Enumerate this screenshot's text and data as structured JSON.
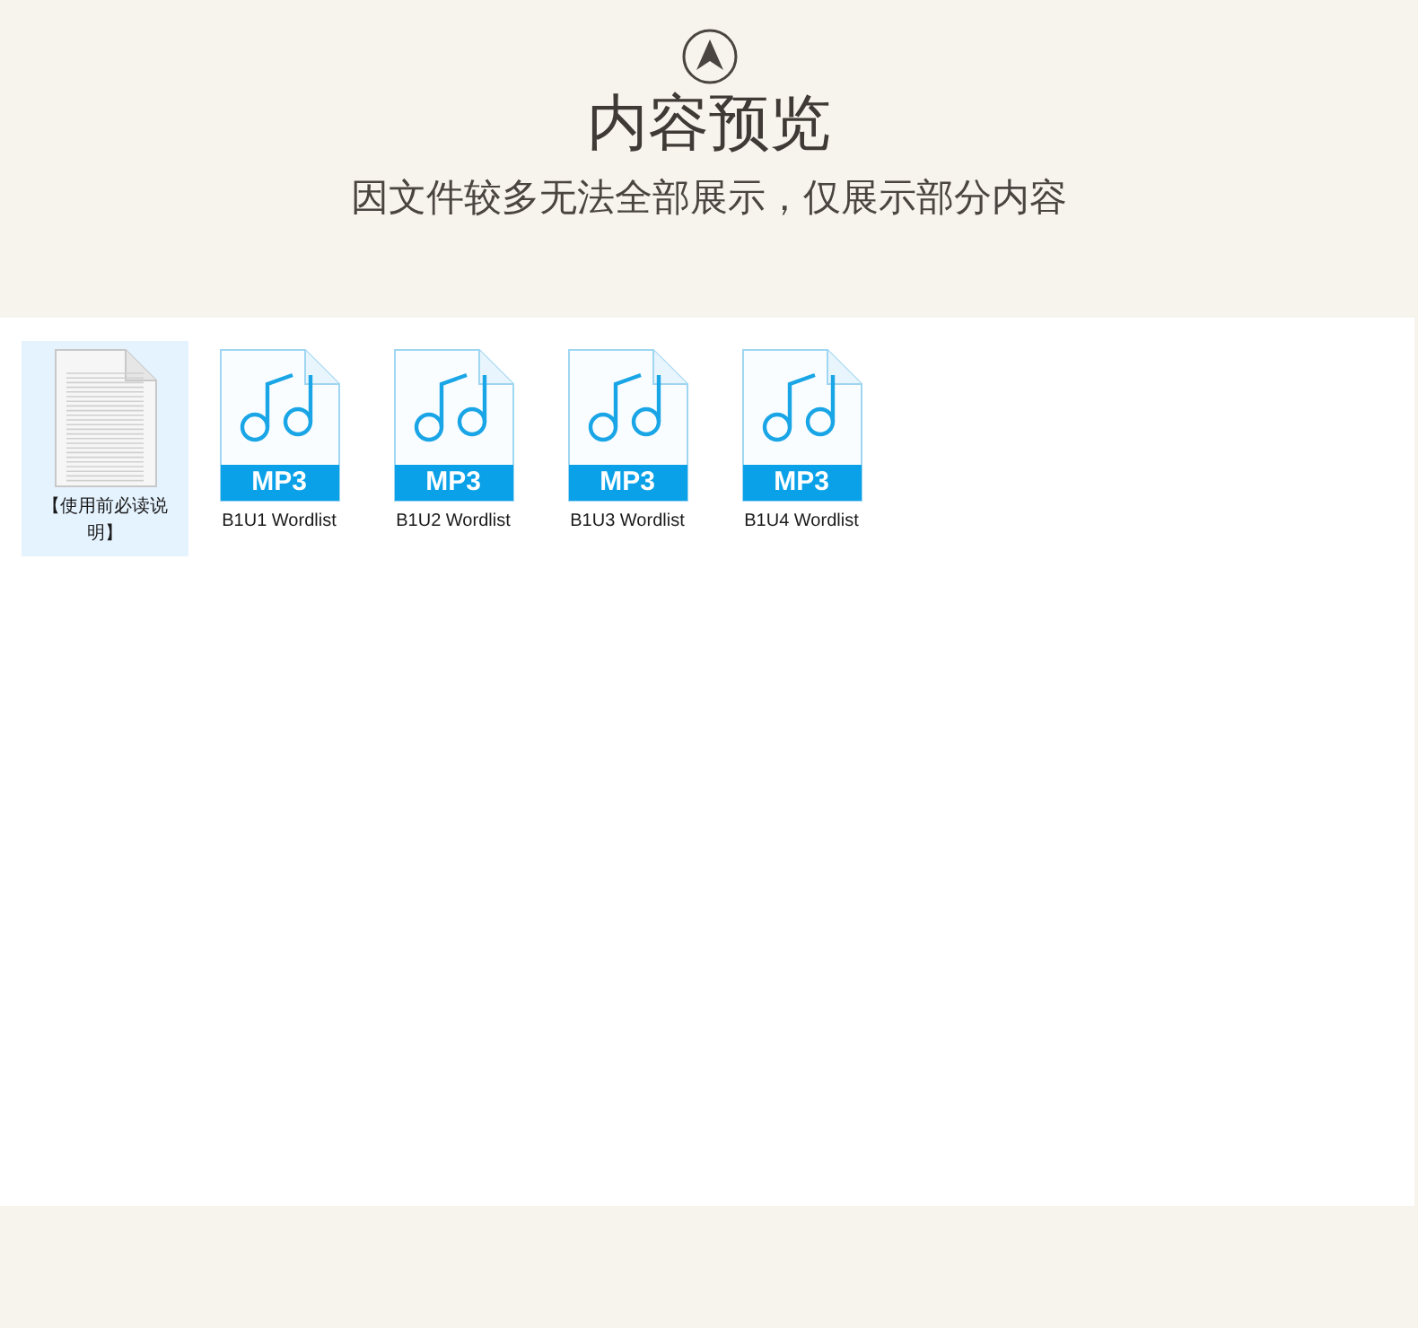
{
  "header": {
    "title": "内容预览",
    "subtitle": "因文件较多无法全部展示，仅展示部分内容"
  },
  "files": [
    {
      "kind": "doc",
      "name": "【使用前必读说明】",
      "selected": true
    },
    {
      "kind": "mp3",
      "name": "B1U1 Wordlist",
      "badge": "MP3",
      "selected": false
    },
    {
      "kind": "mp3",
      "name": "B1U2 Wordlist",
      "badge": "MP3",
      "selected": false
    },
    {
      "kind": "mp3",
      "name": "B1U3 Wordlist",
      "badge": "MP3",
      "selected": false
    },
    {
      "kind": "mp3",
      "name": "B1U4 Wordlist",
      "badge": "MP3",
      "selected": false
    }
  ]
}
